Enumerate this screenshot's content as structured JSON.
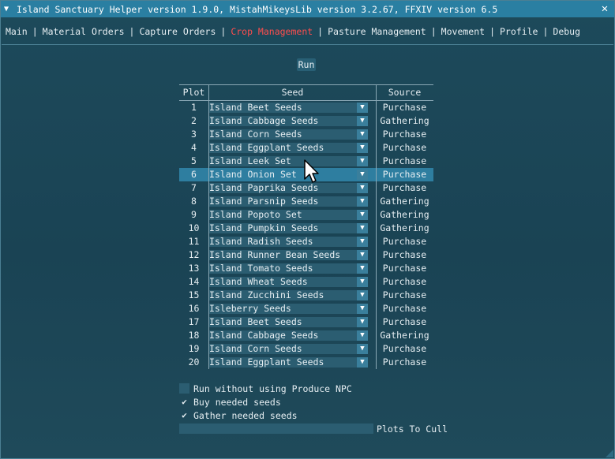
{
  "window": {
    "title": "Island Sanctuary Helper version 1.9.0, MistahMikeysLib version 3.2.67, FFXIV version 6.5",
    "collapse_glyph": "▼",
    "close_glyph": "✕"
  },
  "menu": {
    "items": [
      {
        "label": "Main"
      },
      {
        "label": "Material Orders"
      },
      {
        "label": "Capture Orders"
      },
      {
        "label": "Crop Management",
        "active": true
      },
      {
        "label": "Pasture Management"
      },
      {
        "label": "Movement"
      },
      {
        "label": "Profile"
      },
      {
        "label": "Debug"
      }
    ],
    "separator": "|"
  },
  "run_button": "Run",
  "table": {
    "headers": {
      "plot": "Plot",
      "seed": "Seed",
      "source": "Source"
    },
    "rows": [
      {
        "plot": "1",
        "seed": "Island Beet Seeds",
        "source": "Purchase"
      },
      {
        "plot": "2",
        "seed": "Island Cabbage Seeds",
        "source": "Gathering"
      },
      {
        "plot": "3",
        "seed": "Island Corn Seeds",
        "source": "Purchase"
      },
      {
        "plot": "4",
        "seed": "Island Eggplant Seeds",
        "source": "Purchase"
      },
      {
        "plot": "5",
        "seed": "Island Leek Set",
        "source": "Purchase"
      },
      {
        "plot": "6",
        "seed": "Island Onion Set",
        "source": "Purchase",
        "selected": true
      },
      {
        "plot": "7",
        "seed": "Island Paprika Seeds",
        "source": "Purchase"
      },
      {
        "plot": "8",
        "seed": "Island Parsnip Seeds",
        "source": "Gathering"
      },
      {
        "plot": "9",
        "seed": "Island Popoto Set",
        "source": "Gathering"
      },
      {
        "plot": "10",
        "seed": "Island Pumpkin Seeds",
        "source": "Gathering"
      },
      {
        "plot": "11",
        "seed": "Island Radish Seeds",
        "source": "Purchase"
      },
      {
        "plot": "12",
        "seed": "Island Runner Bean Seeds",
        "source": "Purchase"
      },
      {
        "plot": "13",
        "seed": "Island Tomato Seeds",
        "source": "Purchase"
      },
      {
        "plot": "14",
        "seed": "Island Wheat Seeds",
        "source": "Purchase"
      },
      {
        "plot": "15",
        "seed": "Island Zucchini Seeds",
        "source": "Purchase"
      },
      {
        "plot": "16",
        "seed": "Isleberry Seeds",
        "source": "Purchase"
      },
      {
        "plot": "17",
        "seed": "Island Beet Seeds",
        "source": "Purchase"
      },
      {
        "plot": "18",
        "seed": "Island Cabbage Seeds",
        "source": "Gathering"
      },
      {
        "plot": "19",
        "seed": "Island Corn Seeds",
        "source": "Purchase"
      },
      {
        "plot": "20",
        "seed": "Island Eggplant Seeds",
        "source": "Purchase"
      }
    ],
    "dropdown_glyph": "▼"
  },
  "options": [
    {
      "label": "Run without using Produce NPC",
      "checked": false
    },
    {
      "label": "Buy needed seeds",
      "checked": true
    },
    {
      "label": "Gather needed seeds",
      "checked": true
    }
  ],
  "check_glyph": "✔",
  "plots_to_cull": {
    "label": "Plots To Cull",
    "value": ""
  },
  "colors": {
    "window_bg": "#1b4455",
    "titlebar": "#2a7fa2",
    "active_menu": "#ff4d4d",
    "selected_row": "#2e7ea0",
    "frame_bg": "#2b5d71"
  }
}
